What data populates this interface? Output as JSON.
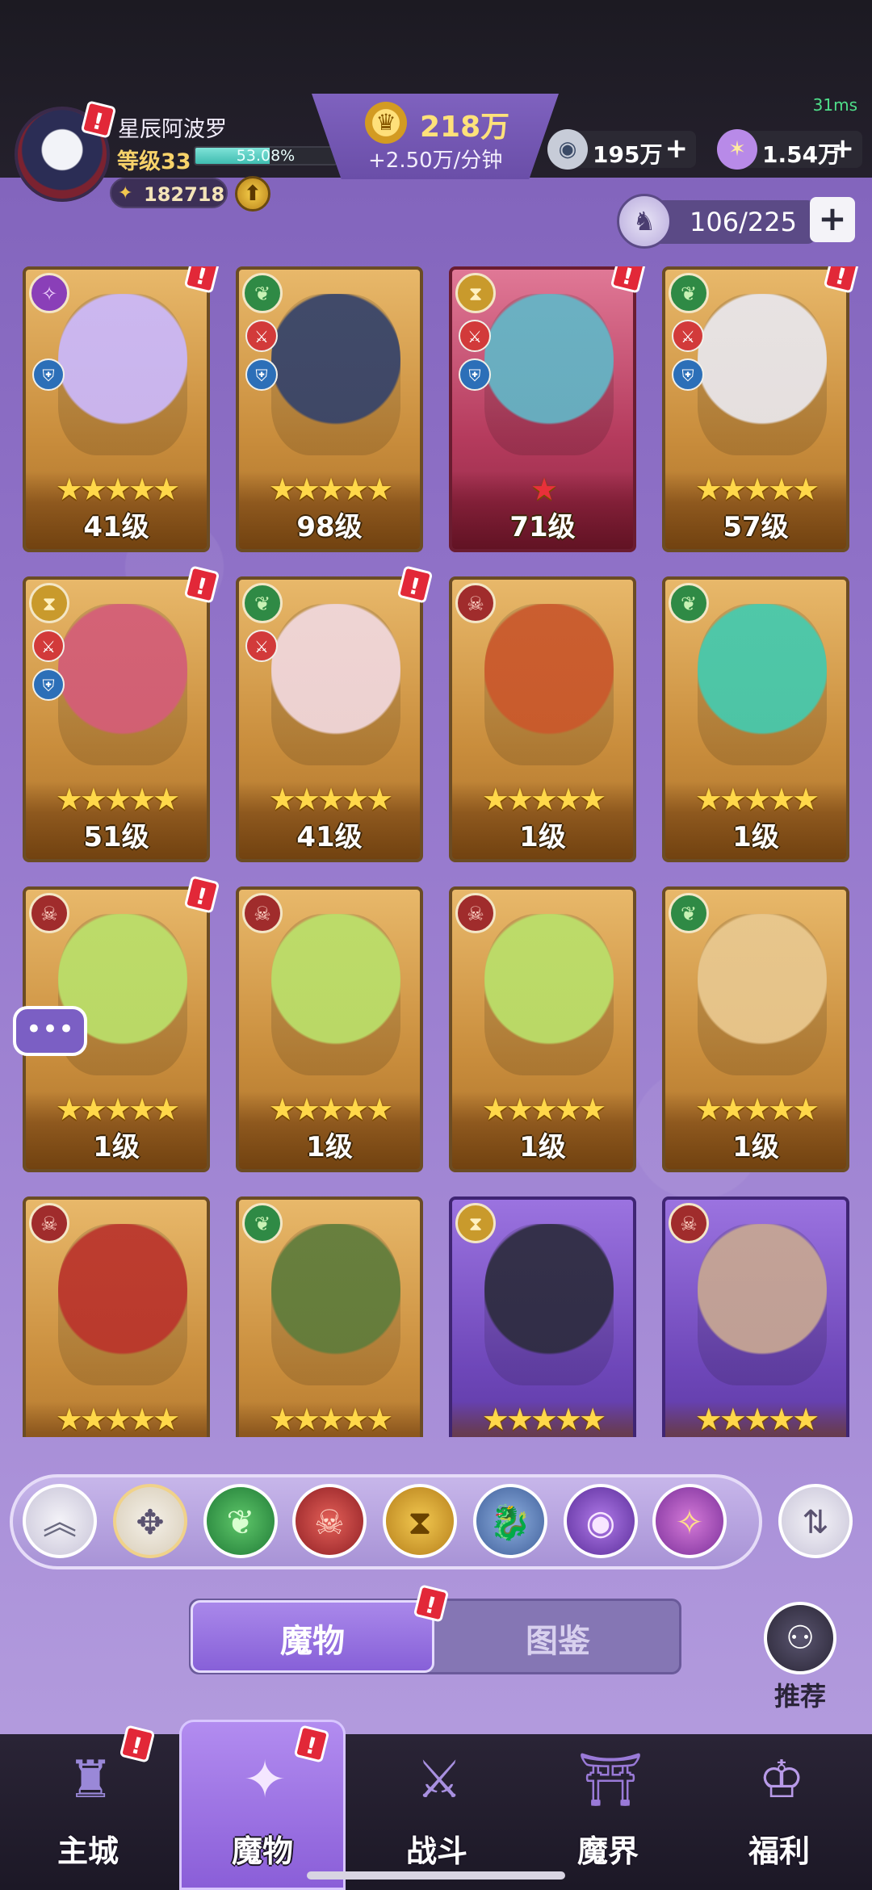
{
  "status": {
    "ping": "31ms"
  },
  "player": {
    "name": "星辰阿波罗",
    "level_label": "等级33",
    "exp_percent": "53.08%",
    "exp_fraction": 0.5308,
    "power": "182718"
  },
  "resources": {
    "gold": "218万",
    "gold_rate": "+2.50万/分钟",
    "silver": "195万",
    "crystal": "1.54万"
  },
  "capacity": {
    "text": "106/225"
  },
  "cards": [
    {
      "element": "magic",
      "level": "41级",
      "stars": 5,
      "red_stars": 0,
      "color": "gold",
      "sword": false,
      "shield": true,
      "alert": true
    },
    {
      "element": "nature",
      "level": "98级",
      "stars": 5,
      "red_stars": 0,
      "color": "gold",
      "sword": true,
      "shield": true,
      "alert": false
    },
    {
      "element": "time",
      "level": "71级",
      "stars": 0,
      "red_stars": 1,
      "color": "red",
      "sword": true,
      "shield": true,
      "alert": true
    },
    {
      "element": "nature",
      "level": "57级",
      "stars": 5,
      "red_stars": 0,
      "color": "gold",
      "sword": true,
      "shield": true,
      "alert": true
    },
    {
      "element": "time",
      "level": "51级",
      "stars": 5,
      "red_stars": 0,
      "color": "gold",
      "sword": true,
      "shield": true,
      "alert": true
    },
    {
      "element": "nature",
      "level": "41级",
      "stars": 5,
      "red_stars": 0,
      "color": "gold",
      "sword": true,
      "shield": false,
      "alert": true
    },
    {
      "element": "demon",
      "level": "1级",
      "stars": 5,
      "red_stars": 0,
      "color": "gold",
      "sword": false,
      "shield": false,
      "alert": false
    },
    {
      "element": "nature",
      "level": "1级",
      "stars": 5,
      "red_stars": 0,
      "color": "gold",
      "sword": false,
      "shield": false,
      "alert": false
    },
    {
      "element": "demon",
      "level": "1级",
      "stars": 5,
      "red_stars": 0,
      "color": "gold",
      "sword": false,
      "shield": false,
      "alert": true
    },
    {
      "element": "demon",
      "level": "1级",
      "stars": 5,
      "red_stars": 0,
      "color": "gold",
      "sword": false,
      "shield": false,
      "alert": false
    },
    {
      "element": "demon",
      "level": "1级",
      "stars": 5,
      "red_stars": 0,
      "color": "gold",
      "sword": false,
      "shield": false,
      "alert": false
    },
    {
      "element": "nature",
      "level": "1级",
      "stars": 5,
      "red_stars": 0,
      "color": "gold",
      "sword": false,
      "shield": false,
      "alert": false
    },
    {
      "element": "demon",
      "level": "",
      "stars": 5,
      "red_stars": 0,
      "color": "gold",
      "sword": false,
      "shield": false,
      "alert": false
    },
    {
      "element": "nature",
      "level": "",
      "stars": 5,
      "red_stars": 0,
      "color": "gold",
      "sword": false,
      "shield": false,
      "alert": false
    },
    {
      "element": "time",
      "level": "",
      "stars": 5,
      "red_stars": 0,
      "color": "purple",
      "sword": false,
      "shield": false,
      "alert": false
    },
    {
      "element": "demon",
      "level": "",
      "stars": 5,
      "red_stars": 0,
      "color": "purple",
      "sword": false,
      "shield": false,
      "alert": false
    }
  ],
  "filters": [
    "collapse",
    "all",
    "nature",
    "demon",
    "time",
    "beast",
    "eye",
    "magic"
  ],
  "tabs": {
    "active": "魔物",
    "inactive": "图鉴"
  },
  "recommend": {
    "label": "推荐"
  },
  "nav": [
    {
      "label": "主城",
      "icon": "castle-icon",
      "active": false,
      "alert": true
    },
    {
      "label": "魔物",
      "icon": "flame-icon",
      "active": true,
      "alert": true
    },
    {
      "label": "战斗",
      "icon": "sword-shield-icon",
      "active": false,
      "alert": false
    },
    {
      "label": "魔界",
      "icon": "portal-icon",
      "active": false,
      "alert": false
    },
    {
      "label": "福利",
      "icon": "chest-icon",
      "active": false,
      "alert": false
    }
  ]
}
